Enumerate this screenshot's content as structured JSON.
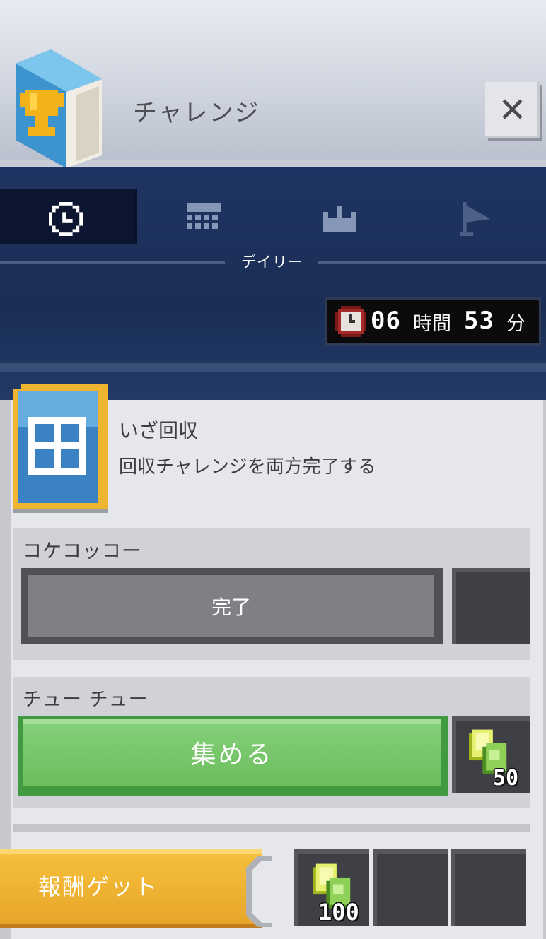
{
  "header": {
    "title": "チャレンジ",
    "close_label": "✕"
  },
  "nav": {
    "tabs": [
      {
        "name": "daily",
        "icon": "clock-icon",
        "active": true
      },
      {
        "name": "weekly",
        "icon": "calendar-icon",
        "active": false
      },
      {
        "name": "kingdom",
        "icon": "castle-icon",
        "active": false
      },
      {
        "name": "flag",
        "icon": "flag-icon",
        "active": false
      }
    ],
    "active_label": "デイリー"
  },
  "timer": {
    "hours": "06",
    "hours_unit": "時間",
    "minutes": "53",
    "minutes_unit": "分"
  },
  "challenge": {
    "title": "いざ回収",
    "description": "回収チャレンジを両方完了する",
    "subtasks": [
      {
        "label": "コケコッコー",
        "status_label": "完了",
        "reward_qty": ""
      },
      {
        "label": "チュー チュー",
        "button_label": "集める",
        "reward_qty": "50"
      }
    ]
  },
  "reward": {
    "button_label": "報酬ゲット ",
    "slots": [
      {
        "qty": "100"
      },
      {
        "qty": ""
      },
      {
        "qty": ""
      }
    ]
  },
  "colors": {
    "accent_gold": "#f0b530",
    "collect_green": "#6cbd5e",
    "nav_bg": "#1c3058"
  }
}
